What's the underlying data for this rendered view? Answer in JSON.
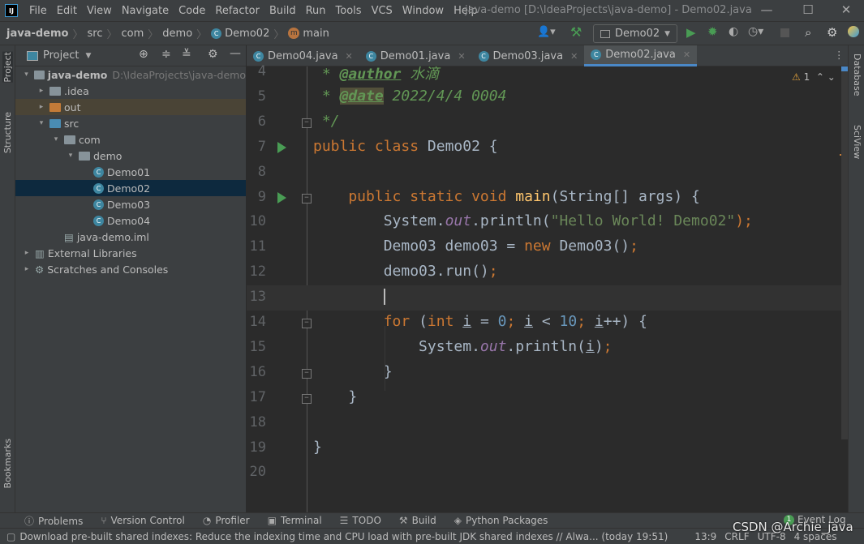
{
  "window": {
    "title": "java-demo [D:\\IdeaProjects\\java-demo] - Demo02.java",
    "logo": "IJ"
  },
  "menu": [
    "File",
    "Edit",
    "View",
    "Navigate",
    "Code",
    "Refactor",
    "Build",
    "Run",
    "Tools",
    "VCS",
    "Window",
    "Help"
  ],
  "breadcrumb": [
    "java-demo",
    "src",
    "com",
    "demo",
    "Demo02",
    "main"
  ],
  "run_config": "Demo02",
  "left_strip": {
    "project": "Project",
    "structure": "Structure",
    "bookmarks": "Bookmarks"
  },
  "right_strip": {
    "database": "Database",
    "sciview": "SciView"
  },
  "project_panel": {
    "title": "Project"
  },
  "tree": [
    {
      "label": "java-demo",
      "extra": "D:\\IdeaProjects\\java-demo",
      "depth": 0,
      "arrow": "▾",
      "icon": "module"
    },
    {
      "label": ".idea",
      "depth": 1,
      "arrow": "▸",
      "icon": "folder"
    },
    {
      "label": "out",
      "depth": 1,
      "arrow": "▸",
      "icon": "folder-orange"
    },
    {
      "label": "src",
      "depth": 1,
      "arrow": "▾",
      "icon": "folder-blue"
    },
    {
      "label": "com",
      "depth": 2,
      "arrow": "▾",
      "icon": "package"
    },
    {
      "label": "demo",
      "depth": 3,
      "arrow": "▾",
      "icon": "package"
    },
    {
      "label": "Demo01",
      "depth": 4,
      "arrow": "",
      "icon": "class"
    },
    {
      "label": "Demo02",
      "depth": 4,
      "arrow": "",
      "icon": "class",
      "selected": true
    },
    {
      "label": "Demo03",
      "depth": 4,
      "arrow": "",
      "icon": "class"
    },
    {
      "label": "Demo04",
      "depth": 4,
      "arrow": "",
      "icon": "class"
    },
    {
      "label": "java-demo.iml",
      "depth": 2,
      "arrow": "",
      "icon": "iml"
    },
    {
      "label": "External Libraries",
      "depth": 0,
      "arrow": "▸",
      "icon": "library"
    },
    {
      "label": "Scratches and Consoles",
      "depth": 0,
      "arrow": "▸",
      "icon": "scratches"
    }
  ],
  "tabs": [
    {
      "label": "Demo04.java"
    },
    {
      "label": "Demo01.java"
    },
    {
      "label": "Demo03.java"
    },
    {
      "label": "Demo02.java",
      "active": true
    }
  ],
  "inspection": {
    "warnings": "1"
  },
  "code": [
    {
      "n": "4",
      "t": [
        [
          " * ",
          "doc"
        ],
        [
          "@author",
          "tag"
        ],
        [
          " 水滴",
          "doc"
        ]
      ]
    },
    {
      "n": "5",
      "t": [
        [
          " * ",
          "doc"
        ],
        [
          "@date",
          "tagh"
        ],
        [
          " 2022/4/4 0004",
          "doc"
        ]
      ]
    },
    {
      "n": "6",
      "t": [
        [
          " */",
          "doc"
        ]
      ],
      "fold": true
    },
    {
      "n": "7",
      "t": [
        [
          "public class ",
          "kw"
        ],
        [
          "Demo02 {",
          ""
        ]
      ],
      "run": true
    },
    {
      "n": "8",
      "t": []
    },
    {
      "n": "9",
      "t": [
        [
          "    public static void ",
          "kw"
        ],
        [
          "main",
          "fn"
        ],
        [
          "(String[] args) {",
          ""
        ]
      ],
      "run": true,
      "fold": true
    },
    {
      "n": "10",
      "t": [
        [
          "        System.",
          ""
        ],
        [
          "out",
          "fld"
        ],
        [
          ".println(",
          ""
        ],
        [
          "\"Hello World! Demo02\"",
          "str"
        ],
        [
          ");",
          "kw"
        ]
      ]
    },
    {
      "n": "11",
      "t": [
        [
          "        Demo03 demo03 = ",
          ""
        ],
        [
          "new ",
          "kw"
        ],
        [
          "Demo03()",
          ""
        ],
        [
          ";",
          "kw"
        ]
      ]
    },
    {
      "n": "12",
      "t": [
        [
          "        demo03.run()",
          ""
        ],
        [
          ";",
          "kw"
        ]
      ]
    },
    {
      "n": "13",
      "t": [
        [
          "        ",
          ""
        ]
      ],
      "current": true
    },
    {
      "n": "14",
      "t": [
        [
          "        ",
          ""
        ],
        [
          "for ",
          "kw"
        ],
        [
          "(",
          ""
        ],
        [
          "int ",
          "kw"
        ],
        [
          "i",
          "ul"
        ],
        [
          " = ",
          ""
        ],
        [
          "0",
          "num"
        ],
        [
          "; ",
          "kw"
        ],
        [
          "i",
          "ul"
        ],
        [
          " < ",
          ""
        ],
        [
          "10",
          "num"
        ],
        [
          "; ",
          "kw"
        ],
        [
          "i",
          "ul"
        ],
        [
          "++) {",
          ""
        ]
      ],
      "fold": true
    },
    {
      "n": "15",
      "t": [
        [
          "            System.",
          ""
        ],
        [
          "out",
          "fld"
        ],
        [
          ".println(",
          ""
        ],
        [
          "i",
          "ul"
        ],
        [
          ")",
          ""
        ],
        [
          ";",
          "kw"
        ]
      ]
    },
    {
      "n": "16",
      "t": [
        [
          "        }",
          ""
        ]
      ],
      "fold": true
    },
    {
      "n": "17",
      "t": [
        [
          "    }",
          ""
        ]
      ],
      "fold": true
    },
    {
      "n": "18",
      "t": []
    },
    {
      "n": "19",
      "t": [
        [
          "}",
          ""
        ]
      ]
    },
    {
      "n": "20",
      "t": []
    }
  ],
  "bottom_tools": [
    "Problems",
    "Version Control",
    "Profiler",
    "Terminal",
    "TODO",
    "Build",
    "Python Packages"
  ],
  "event_log": {
    "label": "Event Log",
    "count": "1"
  },
  "status": {
    "message": "Download pre-built shared indexes: Reduce the indexing time and CPU load with pre-built JDK shared indexes // Alwa... (today 19:51)",
    "position": "13:9",
    "line_sep": "CRLF",
    "encoding": "UTF-8",
    "indent": "4 spaces"
  },
  "watermark": "CSDN @Archie_java",
  "colors": {
    "accent": "#4a88c7",
    "keyword": "#cc7832",
    "string": "#6a8759",
    "number": "#6897bb",
    "doc": "#629755",
    "run": "#499c54"
  }
}
